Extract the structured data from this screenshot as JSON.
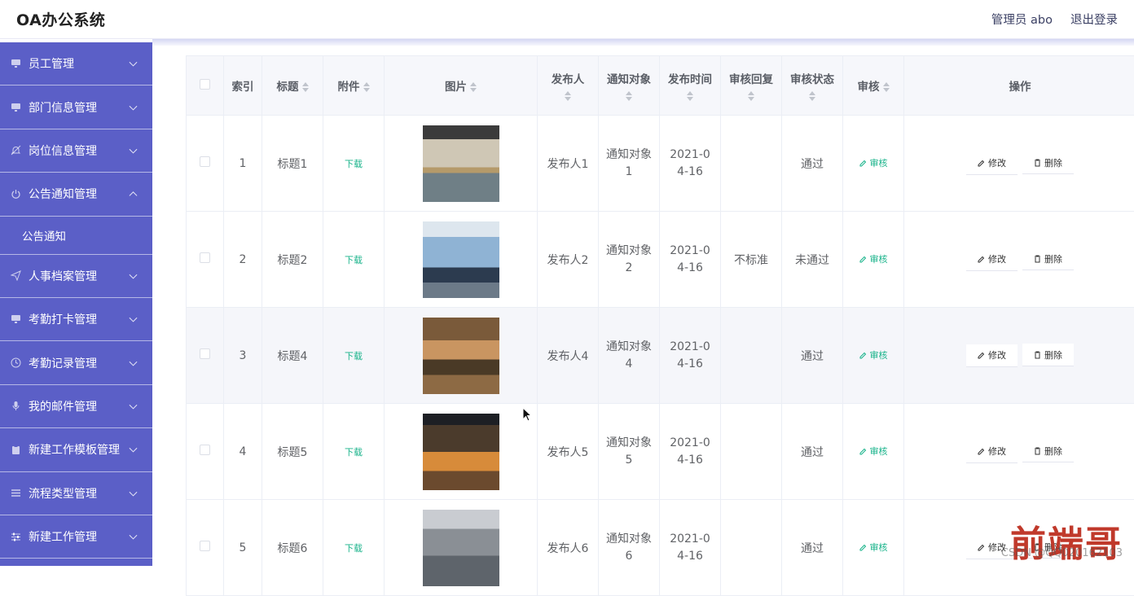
{
  "app": {
    "title": "OA办公系统"
  },
  "header": {
    "user": "管理员 abo",
    "logout": "退出登录"
  },
  "sidebar": {
    "items": [
      {
        "label": "员工管理",
        "icon": "monitor-icon"
      },
      {
        "label": "部门信息管理",
        "icon": "monitor-icon"
      },
      {
        "label": "岗位信息管理",
        "icon": "bell-off-icon"
      },
      {
        "label": "公告通知管理",
        "icon": "power-icon",
        "expanded": true,
        "sub": "公告通知"
      },
      {
        "label": "人事档案管理",
        "icon": "send-icon"
      },
      {
        "label": "考勤打卡管理",
        "icon": "monitor-icon"
      },
      {
        "label": "考勤记录管理",
        "icon": "clock-icon"
      },
      {
        "label": "我的邮件管理",
        "icon": "microphone-icon"
      },
      {
        "label": "新建工作模板管理",
        "icon": "clipboard-icon"
      },
      {
        "label": "流程类型管理",
        "icon": "list-icon"
      },
      {
        "label": "新建工作管理",
        "icon": "sliders-icon"
      }
    ]
  },
  "table": {
    "headers": {
      "index": "索引",
      "title": "标题",
      "attachment": "附件",
      "image": "图片",
      "publisher": "发布人",
      "target": "通知对象",
      "time": "发布时间",
      "reply": "审核回复",
      "status": "审核状态",
      "audit": "审核",
      "ops": "操作"
    },
    "rows": [
      {
        "index": "1",
        "title": "标题1",
        "attachment": "下载",
        "publisher": "发布人1",
        "target": "通知对象1",
        "time": "2021-04-16",
        "reply": "",
        "status": "通过",
        "audit": "审核",
        "edit": "修改",
        "delete": "删除",
        "img": "office-a"
      },
      {
        "index": "2",
        "title": "标题2",
        "attachment": "下载",
        "publisher": "发布人2",
        "target": "通知对象2",
        "time": "2021-04-16",
        "reply": "不标准",
        "status": "未通过",
        "audit": "审核",
        "edit": "修改",
        "delete": "删除",
        "img": "office-b"
      },
      {
        "index": "3",
        "title": "标题4",
        "attachment": "下载",
        "publisher": "发布人4",
        "target": "通知对象4",
        "time": "2021-04-16",
        "reply": "",
        "status": "通过",
        "audit": "审核",
        "edit": "修改",
        "delete": "删除",
        "img": "office-c"
      },
      {
        "index": "4",
        "title": "标题5",
        "attachment": "下载",
        "publisher": "发布人5",
        "target": "通知对象5",
        "time": "2021-04-16",
        "reply": "",
        "status": "通过",
        "audit": "审核",
        "edit": "修改",
        "delete": "删除",
        "img": "office-d"
      },
      {
        "index": "5",
        "title": "标题6",
        "attachment": "下载",
        "publisher": "发布人6",
        "target": "通知对象6",
        "time": "2021-04-16",
        "reply": "",
        "status": "通过",
        "audit": "审核",
        "edit": "修改",
        "delete": "删除",
        "img": "office-e"
      }
    ]
  },
  "watermark": {
    "big": "前端哥",
    "small": "CSDN @QQ020162103"
  },
  "colors": {
    "sidebar": "#5b5fc7",
    "accent": "#18b38a",
    "headerBg": "#f6f7fb"
  }
}
